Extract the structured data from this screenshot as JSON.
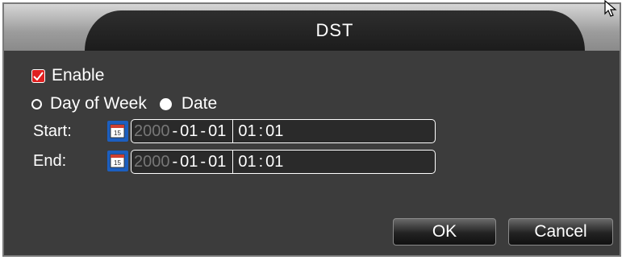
{
  "dialog": {
    "title": "DST"
  },
  "enable": {
    "label": "Enable",
    "checked": true
  },
  "mode": {
    "day_of_week_label": "Day of Week",
    "date_label": "Date",
    "selected": "Date"
  },
  "start": {
    "label": "Start:",
    "year": "2000",
    "month": "01",
    "day": "01",
    "hour": "01",
    "minute": "01"
  },
  "end": {
    "label": "End:",
    "year": "2000",
    "month": "01",
    "day": "01",
    "hour": "01",
    "minute": "01"
  },
  "buttons": {
    "ok": "OK",
    "cancel": "Cancel"
  },
  "separators": {
    "date": "-",
    "time": ":"
  },
  "colors": {
    "background": "#3a3a3a",
    "checkbox": "#e02020",
    "calendar_icon": "#1c5fc0"
  }
}
